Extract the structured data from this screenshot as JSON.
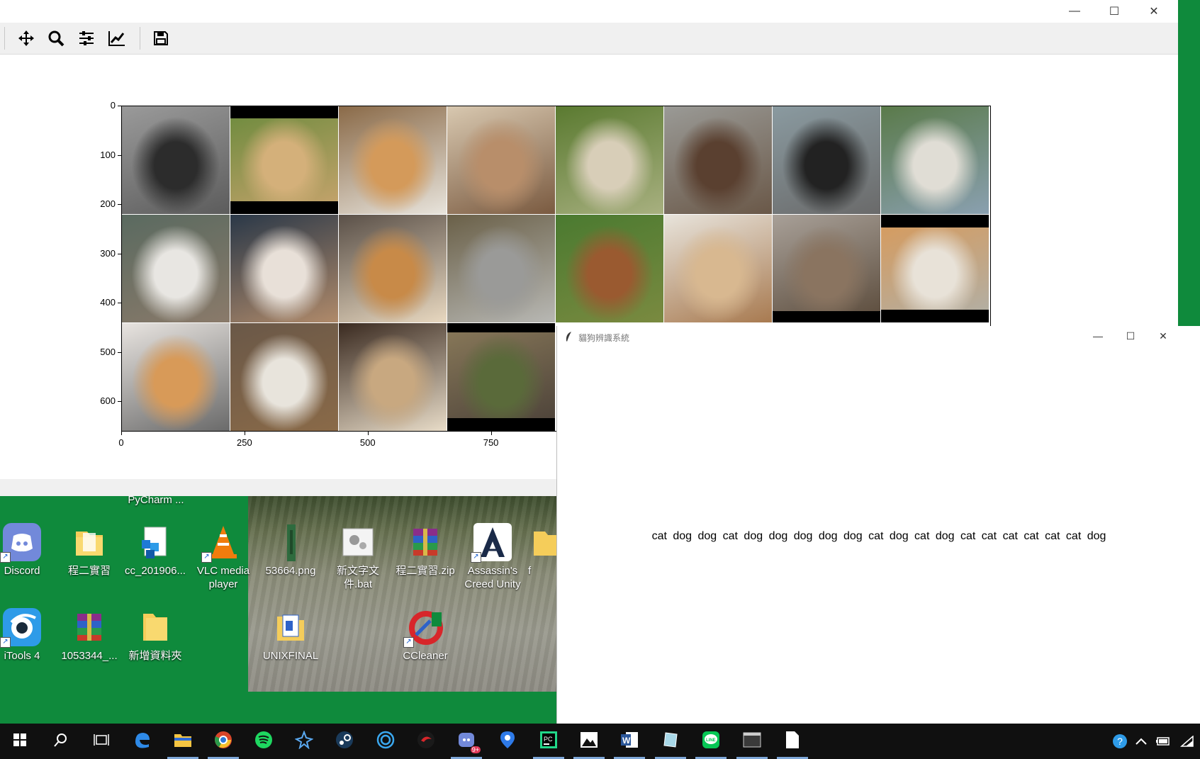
{
  "desktop": {
    "icons": [
      {
        "label": "PyCharm ...",
        "icon": "pycharm-icon"
      },
      {
        "label": "Discord",
        "icon": "discord-icon"
      },
      {
        "label": "程二實習",
        "icon": "folder-icon"
      },
      {
        "label": "cc_201906...",
        "icon": "installer-icon"
      },
      {
        "label": "VLC media player",
        "icon": "vlc-icon"
      },
      {
        "label": "53664.png",
        "icon": "png-file-icon"
      },
      {
        "label": "新文字文件.bat",
        "icon": "bat-file-icon"
      },
      {
        "label": "程二實習.zip",
        "icon": "winrar-archive-icon"
      },
      {
        "label": "Assassin's Creed Unity",
        "icon": "assassins-creed-icon"
      },
      {
        "label": "f",
        "icon": "folder-icon"
      },
      {
        "label": "iTools 4",
        "icon": "itools-icon"
      },
      {
        "label": "1053344_...",
        "icon": "winrar-archive-icon"
      },
      {
        "label": "新增資料夾",
        "icon": "folder-icon"
      },
      {
        "label": "UNIXFINAL",
        "icon": "document-folder-icon"
      },
      {
        "label": "CCleaner",
        "icon": "ccleaner-icon"
      }
    ]
  },
  "plot_window": {
    "controls": {
      "minimize": "—",
      "maximize": "☐",
      "close": "✕"
    },
    "toolbar": [
      {
        "name": "pan-button",
        "icon": "move-arrows-icon"
      },
      {
        "name": "zoom-button",
        "icon": "magnifier-icon"
      },
      {
        "name": "configure-subplots-button",
        "icon": "sliders-icon"
      },
      {
        "name": "edit-axis-button",
        "icon": "line-chart-icon"
      },
      {
        "name": "save-figure-button",
        "icon": "floppy-disk-icon"
      }
    ]
  },
  "chart_data": {
    "type": "image",
    "y_ticks": [
      "0",
      "100",
      "200",
      "300",
      "400",
      "500",
      "600"
    ],
    "x_ticks": [
      "0",
      "250",
      "500",
      "750"
    ],
    "grid": "3 rows x 8 columns of photo tiles",
    "tiles": [
      {
        "subject": "black cat on blanket",
        "colors": [
          "#2c2c2c",
          "#9a9a9a",
          "#5c5c5c"
        ]
      },
      {
        "subject": "tan dog on grass",
        "colors": [
          "#d4b07a",
          "#6a8a3c",
          "#c9a46e"
        ]
      },
      {
        "subject": "shiba dog lying on wood",
        "colors": [
          "#d49a5a",
          "#8a6a48",
          "#e8e4dc"
        ]
      },
      {
        "subject": "tabby cat on quilt",
        "colors": [
          "#b88e6a",
          "#d8c8b0",
          "#7a5a40"
        ]
      },
      {
        "subject": "cream dog on grass",
        "colors": [
          "#d8ceb8",
          "#5a7a30",
          "#a8b080"
        ]
      },
      {
        "subject": "brown dachshund on tiles",
        "colors": [
          "#5a4030",
          "#9a9a96",
          "#6a5848"
        ]
      },
      {
        "subject": "black dog in basket",
        "colors": [
          "#222222",
          "#8a9aa0",
          "#6a6a6a"
        ]
      },
      {
        "subject": "white dog on rocks",
        "colors": [
          "#e0ddd5",
          "#5a7a4a",
          "#8aa0b0"
        ]
      },
      {
        "subject": "white dog with ball",
        "colors": [
          "#e8e6e2",
          "#5a6a60",
          "#8a7a6a"
        ]
      },
      {
        "subject": "calico cat at door",
        "colors": [
          "#e8e0d8",
          "#2a3848",
          "#b08a6a"
        ]
      },
      {
        "subject": "shiba dog standing",
        "colors": [
          "#c88a48",
          "#5a5048",
          "#e8d8c0"
        ]
      },
      {
        "subject": "fluffy grey cat",
        "colors": [
          "#9a9a98",
          "#6a6048",
          "#b8b8b4"
        ]
      },
      {
        "subject": "brown dog on grass",
        "colors": [
          "#9a5a30",
          "#4a7a30",
          "#7a8a40"
        ]
      },
      {
        "subject": "fluffy cat on bed",
        "colors": [
          "#d8b890",
          "#e8e4dc",
          "#a87a50"
        ]
      },
      {
        "subject": "tabby cat on table",
        "colors": [
          "#8a7460",
          "#a8a098",
          "#5a4a3a"
        ]
      },
      {
        "subject": "orange cat lying",
        "colors": [
          "#e8e2d8",
          "#d89a5a",
          "#b0b0a8"
        ]
      },
      {
        "subject": "orange white cat sitting",
        "colors": [
          "#d89a58",
          "#e8e4e0",
          "#6a6a6a"
        ]
      },
      {
        "subject": "tabby cat on shelf",
        "colors": [
          "#e8e4dc",
          "#6a5848",
          "#8a6a48"
        ]
      },
      {
        "subject": "calico cat on floor",
        "colors": [
          "#c8a880",
          "#3a2a20",
          "#e8dcc8"
        ]
      },
      {
        "subject": "spotted dog on field",
        "colors": [
          "#5a6a3a",
          "#8a7a5a",
          "#4a4038"
        ]
      }
    ]
  },
  "tk_window": {
    "title": "貓狗辨識系統",
    "controls": {
      "minimize": "—",
      "maximize": "☐",
      "close": "✕"
    },
    "result": "cat dog dog cat dog dog dog dog dog cat dog cat dog cat cat cat cat cat cat dog"
  },
  "taskbar": {
    "items": [
      {
        "name": "start-button",
        "icon": "windows-logo-icon"
      },
      {
        "name": "search-button",
        "icon": "search-icon"
      },
      {
        "name": "task-view-button",
        "icon": "task-view-icon"
      },
      {
        "name": "edge-button",
        "icon": "edge-icon"
      },
      {
        "name": "file-explorer-button",
        "icon": "folder-icon"
      },
      {
        "name": "chrome-button",
        "icon": "chrome-icon"
      },
      {
        "name": "spotify-button",
        "icon": "spotify-icon"
      },
      {
        "name": "app-button",
        "icon": "star-app-icon"
      },
      {
        "name": "steam-button",
        "icon": "steam-icon"
      },
      {
        "name": "app-button-2",
        "icon": "spiral-icon"
      },
      {
        "name": "garena-button",
        "icon": "garena-icon"
      },
      {
        "name": "discord-taskbar-button",
        "icon": "discord-icon",
        "badge": "9+"
      },
      {
        "name": "maps-button",
        "icon": "map-pin-icon"
      },
      {
        "name": "pycharm-button",
        "icon": "pycharm-icon"
      },
      {
        "name": "photos-button",
        "icon": "photo-icon"
      },
      {
        "name": "word-button",
        "icon": "word-icon"
      },
      {
        "name": "app-button-3",
        "icon": "tablet-icon"
      },
      {
        "name": "line-button",
        "icon": "line-icon"
      },
      {
        "name": "terminal-button",
        "icon": "terminal-icon"
      },
      {
        "name": "notepad-button",
        "icon": "document-icon"
      }
    ],
    "tray": [
      "help-icon",
      "chevron-up-icon",
      "battery-icon",
      "wifi-icon"
    ]
  }
}
